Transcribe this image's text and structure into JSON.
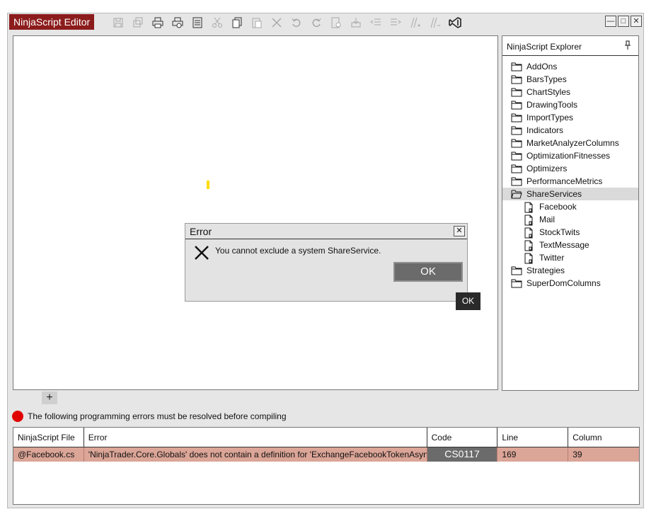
{
  "app": {
    "title": "NinjaScript Editor"
  },
  "toolbar": {
    "icons": [
      "save-icon",
      "save-all-icon",
      "print-icon",
      "print-preview-icon",
      "properties-icon",
      "cut-icon",
      "copy-icon",
      "paste-icon",
      "delete-icon",
      "undo-icon",
      "redo-icon",
      "compile-icon",
      "import-icon",
      "outdent-icon",
      "indent-icon",
      "comment-icon",
      "uncomment-icon",
      "visual-studio-icon"
    ]
  },
  "explorer": {
    "title": "NinjaScript Explorer",
    "items": [
      {
        "label": "AddOns",
        "type": "folder"
      },
      {
        "label": "BarsTypes",
        "type": "folder"
      },
      {
        "label": "ChartStyles",
        "type": "folder"
      },
      {
        "label": "DrawingTools",
        "type": "folder"
      },
      {
        "label": "ImportTypes",
        "type": "folder"
      },
      {
        "label": "Indicators",
        "type": "folder"
      },
      {
        "label": "MarketAnalyzerColumns",
        "type": "folder"
      },
      {
        "label": "OptimizationFitnesses",
        "type": "folder"
      },
      {
        "label": "Optimizers",
        "type": "folder"
      },
      {
        "label": "PerformanceMetrics",
        "type": "folder"
      },
      {
        "label": "ShareServices",
        "type": "folder-open"
      },
      {
        "label": "Facebook",
        "type": "file"
      },
      {
        "label": "Mail",
        "type": "file"
      },
      {
        "label": "StockTwits",
        "type": "file"
      },
      {
        "label": "TextMessage",
        "type": "file"
      },
      {
        "label": "Twitter",
        "type": "file"
      },
      {
        "label": "Strategies",
        "type": "folder"
      },
      {
        "label": "SuperDomColumns",
        "type": "folder"
      }
    ]
  },
  "dialog": {
    "title": "Error",
    "message": "You cannot exclude a system ShareService.",
    "ok_label": "OK",
    "tooltip": "OK"
  },
  "tabs": {
    "add_label": "+"
  },
  "status": {
    "text": "The following programming errors must be resolved before compiling"
  },
  "errors": {
    "headers": {
      "file": "NinjaScript File",
      "error": "Error",
      "code": "Code",
      "line": "Line",
      "column": "Column"
    },
    "rows": [
      {
        "file": "@Facebook.cs",
        "error": "'NinjaTrader.Core.Globals' does not contain a definition for 'ExchangeFacebookTokenAsync'",
        "code": "CS0117",
        "line": "169",
        "column": "39"
      }
    ]
  },
  "colors": {
    "accent": "#8c1c1c",
    "error_row": "#dba597",
    "error_dot": "#e00000",
    "caret": "#ffdd00"
  }
}
